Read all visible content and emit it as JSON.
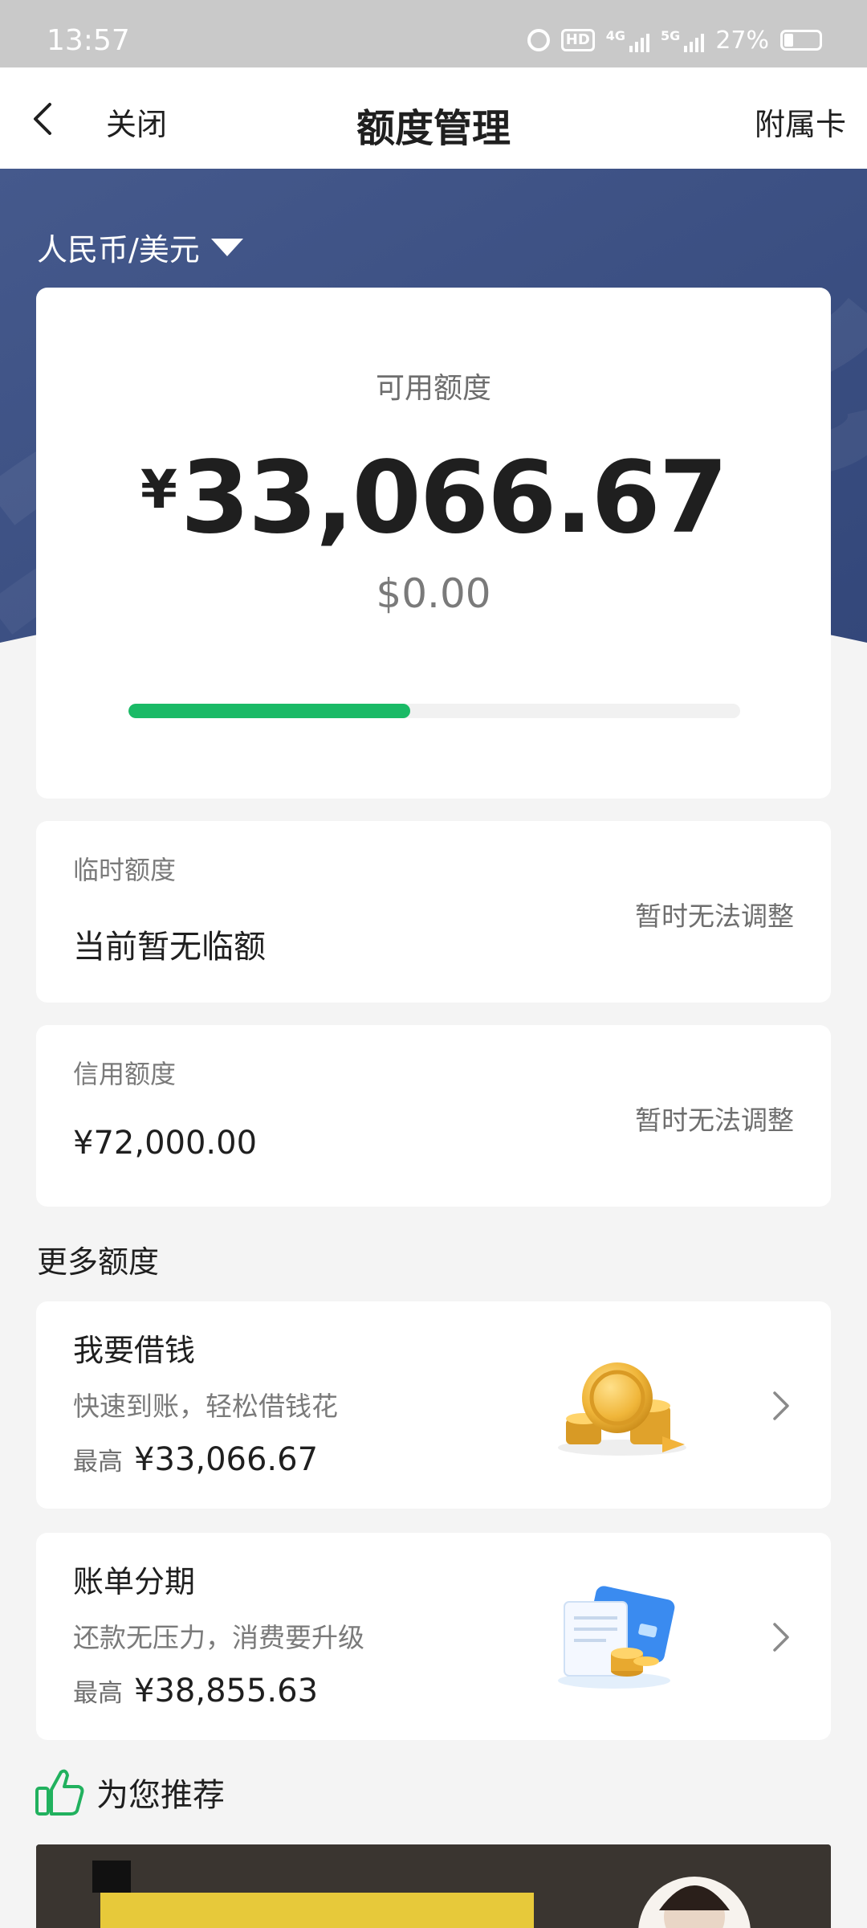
{
  "status_bar": {
    "time": "13:57",
    "hd": "HD",
    "net1": "4G",
    "net2": "5G",
    "battery": "27%"
  },
  "nav": {
    "close": "关闭",
    "title": "额度管理",
    "right": "附属卡"
  },
  "header": {
    "currency_selector": "人民币/美元"
  },
  "available": {
    "label": "可用额度",
    "symbol": "¥",
    "amount": "33,066.67",
    "usd": "$0.00",
    "progress_fraction": 0.46
  },
  "temp_limit": {
    "label": "临时额度",
    "value": "当前暂无临额",
    "action": "暂时无法调整"
  },
  "credit_limit": {
    "label": "信用额度",
    "value": "¥72,000.00",
    "action": "暂时无法调整"
  },
  "more": {
    "title": "更多额度",
    "items": [
      {
        "title": "我要借钱",
        "desc": "快速到账，轻松借钱花",
        "max_label": "最高",
        "max_amount": "¥33,066.67",
        "icon": "gold-coins-icon"
      },
      {
        "title": "账单分期",
        "desc": "还款无压力，消费要升级",
        "max_label": "最高",
        "max_amount": "¥38,855.63",
        "icon": "card-bill-icon"
      }
    ]
  },
  "recommend": {
    "label": "为您推荐"
  },
  "colors": {
    "header_blue": "#3d5184",
    "accent_green": "#1aba66"
  }
}
